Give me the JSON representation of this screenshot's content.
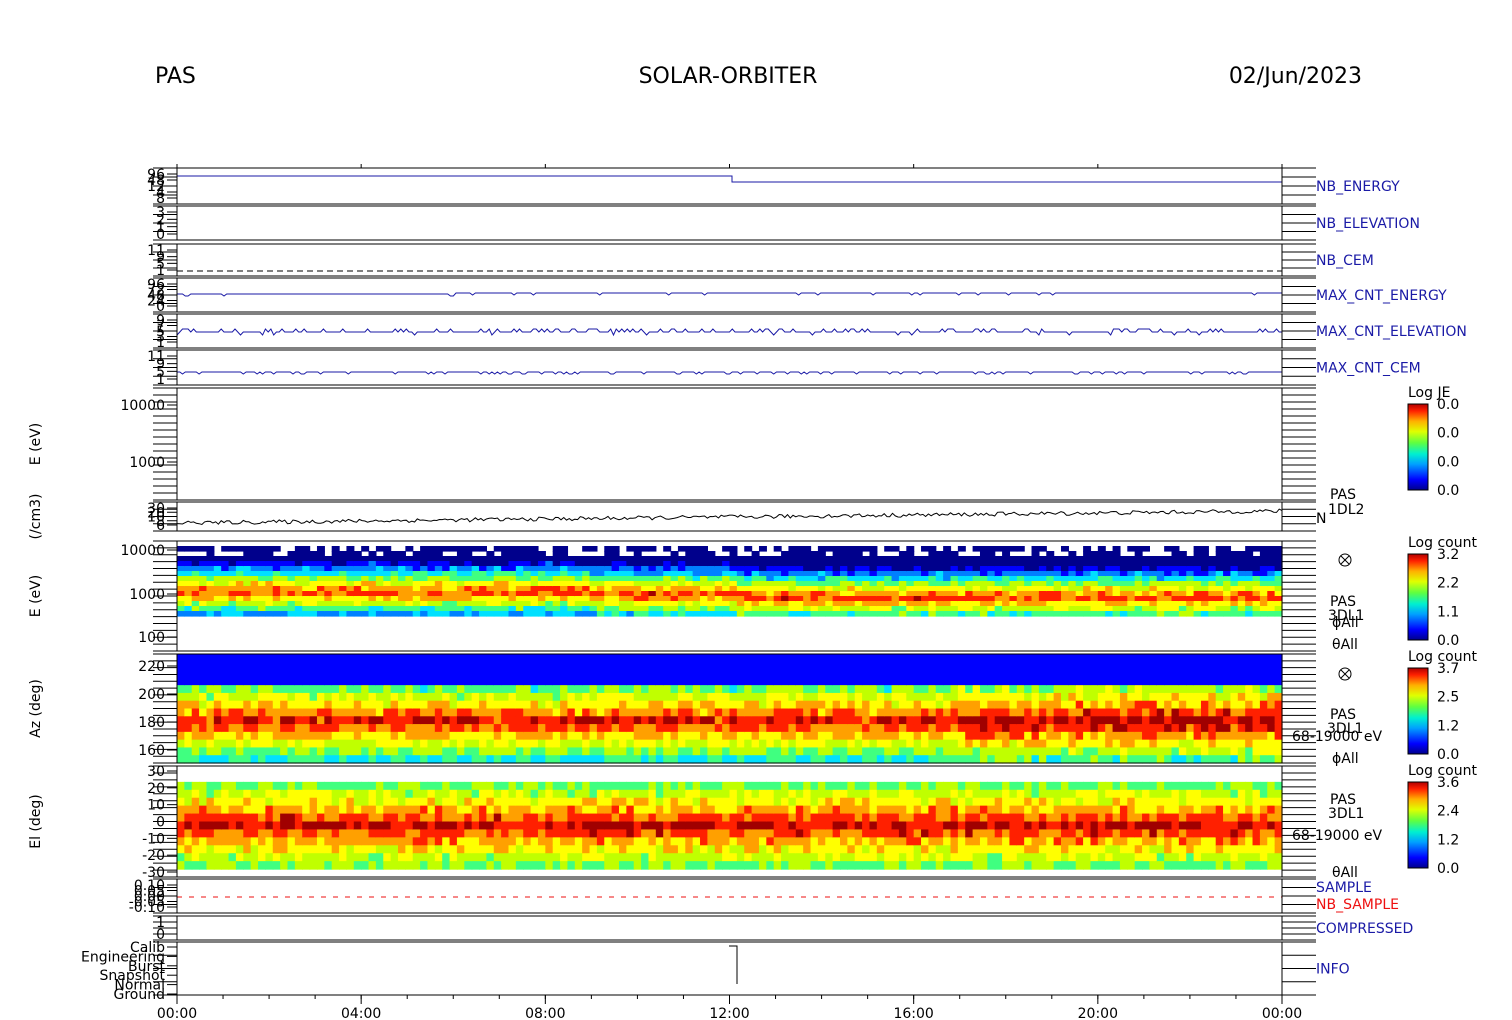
{
  "header": {
    "instrument": "PAS",
    "mission": "SOLAR-ORBITER",
    "date": "02/Jun/2023"
  },
  "colors": {
    "trace": "#1a1aa6",
    "label": "#1a1aa6",
    "sample_line": "#e11",
    "colormap": [
      "#00008c",
      "#0000ff",
      "#0080ff",
      "#00e0ff",
      "#40ff80",
      "#c0ff00",
      "#ffff00",
      "#ffa000",
      "#ff2000",
      "#a00000"
    ]
  },
  "chart_data": {
    "type": "heatmap",
    "x_axis": {
      "ticks": [
        "00:00",
        "04:00",
        "08:00",
        "12:00",
        "16:00",
        "20:00",
        "00:00"
      ]
    },
    "panels": [
      {
        "id": "nb_energy",
        "name": "NB_ENERGY",
        "type": "line",
        "ytick_labels": [
          "96",
          "48",
          "12",
          "4",
          "8"
        ]
      },
      {
        "id": "nb_elevation",
        "name": "NB_ELEVATION",
        "type": "line",
        "ytick_labels": [
          "3",
          "2",
          "1",
          "0"
        ]
      },
      {
        "id": "nb_cem",
        "name": "NB_CEM",
        "type": "line",
        "ytick_labels": [
          "11",
          "9",
          "5",
          "1"
        ]
      },
      {
        "id": "max_cnt_energy",
        "name": "MAX_CNT_ENERGY",
        "type": "line",
        "ytick_labels": [
          "96",
          "72",
          "48",
          "24",
          "0"
        ]
      },
      {
        "id": "max_cnt_elevation",
        "name": "MAX_CNT_ELEVATION",
        "type": "line",
        "ytick_labels": [
          "9",
          "7",
          "5",
          "3",
          "1"
        ]
      },
      {
        "id": "max_cnt_cem",
        "name": "MAX_CNT_CEM",
        "type": "line",
        "ytick_labels": [
          "11",
          "9",
          "5",
          "1"
        ]
      },
      {
        "id": "je",
        "type": "heatmap",
        "ylabel": "E (eV)",
        "yscale": "log",
        "ylim": [
          300,
          15000
        ],
        "ytick_labels": [
          "10000",
          "1000"
        ],
        "colorbar": {
          "title": "Log JE",
          "ticks": [
            "0.0",
            "0.0",
            "0.0",
            "0.0"
          ]
        }
      },
      {
        "id": "density",
        "type": "line",
        "ylabel": "(/cm3)",
        "yscale": "log",
        "ylim": [
          5,
          30
        ],
        "ytick_labels": [
          "30",
          "20",
          "10",
          "8",
          "6"
        ],
        "labels": [
          "PAS",
          "1DL2",
          "N"
        ]
      },
      {
        "id": "energy_spec",
        "type": "heatmap",
        "ylabel": "E (eV)",
        "yscale": "log",
        "ylim": [
          60,
          15000
        ],
        "ytick_labels": [
          "10000",
          "1000",
          "100"
        ],
        "labels": [
          "PAS",
          "3DL1",
          "ϕAll",
          "θAll"
        ],
        "colorbar": {
          "title": "Log count",
          "ticks": [
            "3.2",
            "2.2",
            "1.1",
            "0.0"
          ]
        }
      },
      {
        "id": "az_spec",
        "type": "heatmap",
        "ylabel": "Az (deg)",
        "ylim": [
          152,
          228
        ],
        "ytick_labels": [
          "220",
          "200",
          "180",
          "160"
        ],
        "labels": [
          "PAS",
          "3DL1",
          "68-19000 eV",
          "ϕAll"
        ],
        "colorbar": {
          "title": "Log count",
          "ticks": [
            "3.7",
            "2.5",
            "1.2",
            "0.0"
          ]
        }
      },
      {
        "id": "el_spec",
        "type": "heatmap",
        "ylabel": "El (deg)",
        "ylim": [
          -30,
          30
        ],
        "ytick_labels": [
          "30",
          "20",
          "10",
          "0",
          "-10",
          "-20",
          "-30"
        ],
        "labels": [
          "PAS",
          "3DL1",
          "68-19000 eV",
          "θAll"
        ],
        "colorbar": {
          "title": "Log count",
          "ticks": [
            "3.6",
            "2.4",
            "1.2",
            "0.0"
          ]
        }
      },
      {
        "id": "sample",
        "type": "line",
        "ytick_labels": [
          "0.10",
          "0.05",
          "0.00",
          "-0.05",
          "-0.10"
        ],
        "labels": [
          "SAMPLE",
          "NB_SAMPLE"
        ]
      },
      {
        "id": "compressed",
        "name": "COMPRESSED",
        "type": "line",
        "ytick_labels": [
          "1",
          "0"
        ]
      },
      {
        "id": "info",
        "name": "INFO",
        "type": "line",
        "ytick_labels": [
          "Calib",
          "Engineering",
          "Burst",
          "Snapshot",
          "Normal",
          "Ground"
        ]
      }
    ]
  }
}
